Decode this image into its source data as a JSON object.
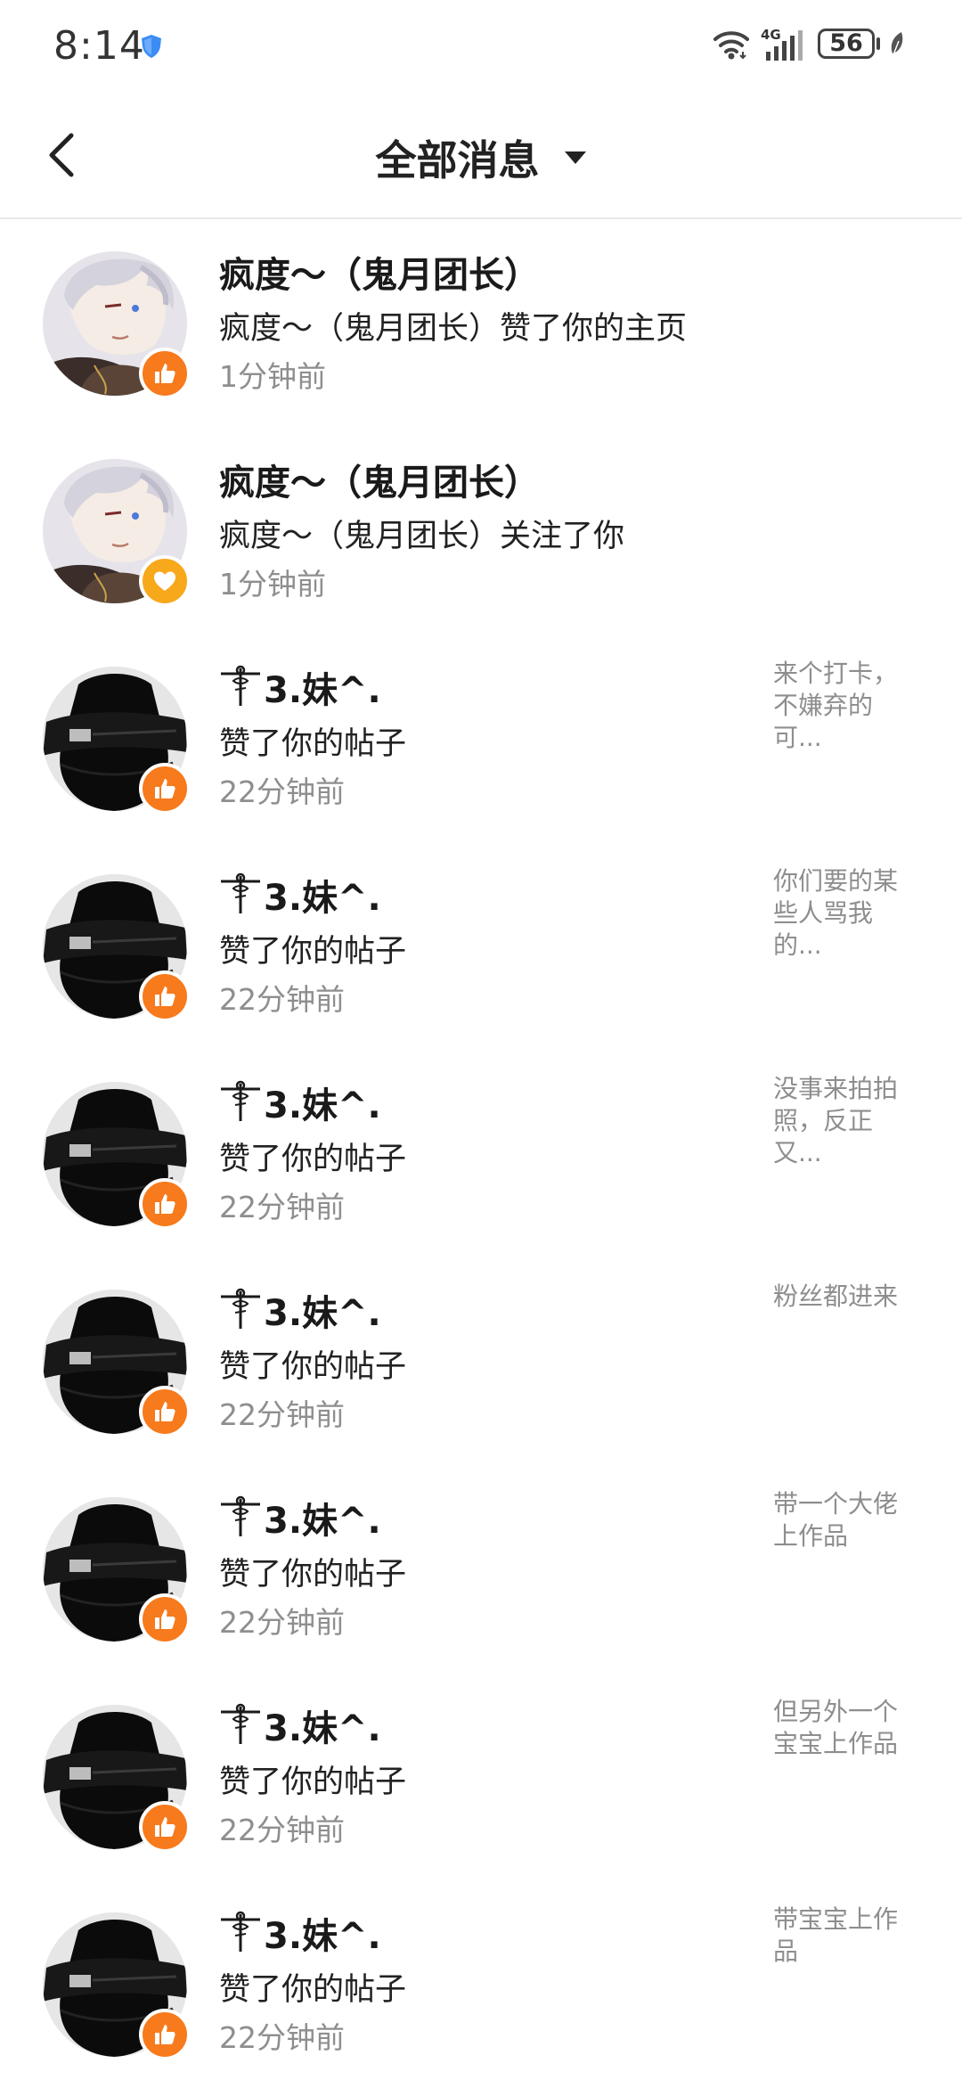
{
  "status_bar": {
    "time": "8:14",
    "network": "4G",
    "battery": "56"
  },
  "header": {
    "title": "全部消息"
  },
  "colors": {
    "like_badge": "#f77a1c",
    "follow_badge": "#f7a81b"
  },
  "notifications": [
    {
      "name": "疯度～（鬼月团长）",
      "action": "疯度～（鬼月团长）赞了你的主页",
      "time": "1分钟前",
      "preview": "",
      "badge": "like-icon",
      "avatar": "anime"
    },
    {
      "name": "疯度～（鬼月团长）",
      "action": "疯度～（鬼月团长）关注了你",
      "time": "1分钟前",
      "preview": "",
      "badge": "heart-icon",
      "avatar": "anime"
    },
    {
      "name": "3.妹^.",
      "action": "赞了你的帖子",
      "time": "22分钟前",
      "preview": "来个打卡，不嫌弃的可...",
      "badge": "like-icon",
      "avatar": "dark"
    },
    {
      "name": "3.妹^.",
      "action": "赞了你的帖子",
      "time": "22分钟前",
      "preview": "你们要的某些人骂我的...",
      "badge": "like-icon",
      "avatar": "dark"
    },
    {
      "name": "3.妹^.",
      "action": "赞了你的帖子",
      "time": "22分钟前",
      "preview": "没事来拍拍照，反正又...",
      "badge": "like-icon",
      "avatar": "dark"
    },
    {
      "name": "3.妹^.",
      "action": "赞了你的帖子",
      "time": "22分钟前",
      "preview": "粉丝都进来",
      "badge": "like-icon",
      "avatar": "dark"
    },
    {
      "name": "3.妹^.",
      "action": "赞了你的帖子",
      "time": "22分钟前",
      "preview": "带一个大佬上作品",
      "badge": "like-icon",
      "avatar": "dark"
    },
    {
      "name": "3.妹^.",
      "action": "赞了你的帖子",
      "time": "22分钟前",
      "preview": "但另外一个宝宝上作品",
      "badge": "like-icon",
      "avatar": "dark"
    },
    {
      "name": "3.妹^.",
      "action": "赞了你的帖子",
      "time": "22分钟前",
      "preview": "带宝宝上作品",
      "badge": "like-icon",
      "avatar": "dark"
    }
  ]
}
